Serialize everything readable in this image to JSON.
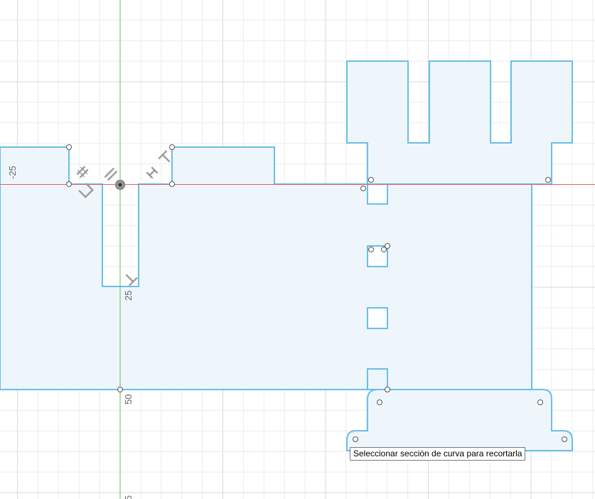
{
  "viewport": {
    "axis_labels": {
      "y_neg25": "-25",
      "x_25": "25",
      "x_50": "50",
      "x_75_partial": "5"
    }
  },
  "colors": {
    "grid_minor": "#ececec",
    "grid_major": "#d9d9d9",
    "profile_fill": "#eef6fc",
    "profile_stroke": "#68bfe8",
    "x_axis": "#e06060",
    "y_axis": "#57c557",
    "constraint_glyph": "#9a9a9a"
  },
  "tooltip": {
    "text": "Seleccionar sección de curva para recortarla"
  }
}
